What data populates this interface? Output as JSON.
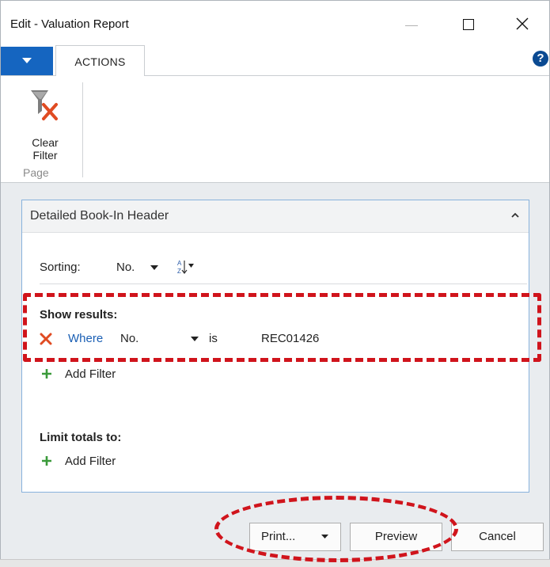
{
  "window": {
    "title": "Edit - Valuation Report"
  },
  "ribbon": {
    "tab_label": "ACTIONS",
    "help_symbol": "?",
    "clear_filter_line1": "Clear",
    "clear_filter_line2": "Filter",
    "group_label": "Page"
  },
  "panel": {
    "title": "Detailed Book-In Header",
    "sorting_label": "Sorting:",
    "sorting_value": "No.",
    "show_results_label": "Show results:",
    "filter": {
      "where_label": "Where",
      "field": "No.",
      "operator": "is",
      "value": "REC01426"
    },
    "add_filter_label": "Add Filter",
    "limit_totals_label": "Limit totals to:",
    "add_filter_label_2": "Add Filter"
  },
  "buttons": {
    "print_label": "Print...",
    "preview_label": "Preview",
    "cancel_label": "Cancel"
  },
  "colors": {
    "accent": "#1565c0",
    "highlight": "#d0141c",
    "link": "#1a5fb4",
    "panel_border": "#88b2dc"
  },
  "icons": [
    "chevron-down-icon",
    "help-icon",
    "clear-filter-icon",
    "collapse-icon",
    "sort-direction-icon",
    "remove-filter-icon",
    "plus-icon",
    "close-icon",
    "minimize-icon",
    "maximize-icon"
  ]
}
